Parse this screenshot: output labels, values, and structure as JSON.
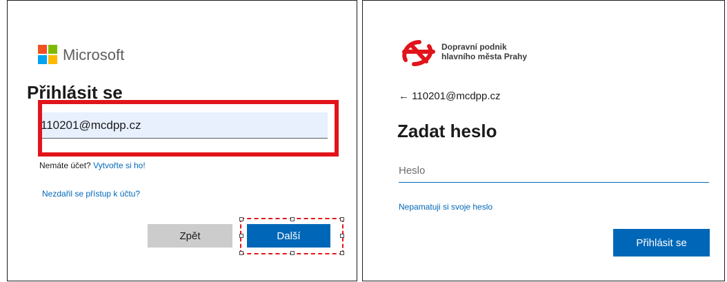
{
  "colors": {
    "accent": "#0067b8",
    "highlight": "#e1141b",
    "ms_red": "#f25022",
    "ms_green": "#7fba00",
    "ms_blue": "#00a4ef",
    "ms_yellow": "#ffb900",
    "dpp_red": "#e1141b"
  },
  "left": {
    "brand": "Microsoft",
    "title": "Přihlásit se",
    "email_value": "110201@mcdpp.cz",
    "no_account_text": "Nemáte účet?",
    "create_link": "Vytvořte si ho!",
    "cant_access_link": "Nezdařil se přístup k účtu?",
    "back_button": "Zpět",
    "next_button": "Další"
  },
  "right": {
    "brand_line1": "Dopravní podnik",
    "brand_line2": "hlavního města Prahy",
    "back_icon": "←",
    "account": "110201@mcdpp.cz",
    "title": "Zadat heslo",
    "password_placeholder": "Heslo",
    "forgot_link": "Nepamatuji si svoje heslo",
    "signin_button": "Přihlásit se"
  }
}
